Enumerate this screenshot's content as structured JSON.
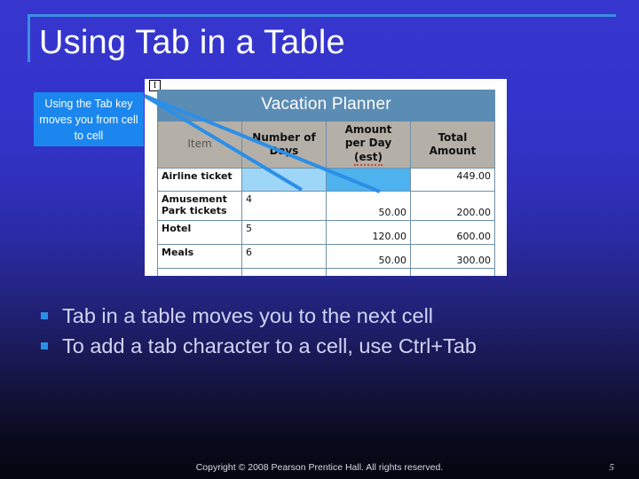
{
  "slide": {
    "title": "Using Tab in a Table",
    "background_top_color": "#3636cf",
    "background_bottom_color": "#050510",
    "accent_color": "#3b8fe0"
  },
  "callout": {
    "text": "Using the Tab key moves you from cell to cell",
    "fill_color": "#1b87ee",
    "text_color": "#ffffff"
  },
  "screenshot": {
    "cursor_icon": "text-cursor-icon",
    "cursor_glyph": "I"
  },
  "word_table": {
    "title": "Vacation Planner",
    "title_fill": "#5b8cb4",
    "header_fill": "#b4b0a8",
    "headers": [
      "Item",
      "Number of Days",
      "Amount per Day (est)",
      "Total Amount"
    ],
    "header_parts": {
      "item": "Item",
      "days_l1": "Number of",
      "days_l2": "Days",
      "amount_l1": "Amount",
      "amount_l2": "per Day",
      "amount_l3": "(est)",
      "total_l1": "Total",
      "total_l2": "Amount"
    },
    "rows": [
      {
        "item": "Airline ticket",
        "days": "",
        "amount": "",
        "total": "449.00",
        "selected": true
      },
      {
        "item": "Amusement Park tickets",
        "days": "4",
        "amount": "50.00",
        "total": "200.00",
        "selected": false
      },
      {
        "item": "Hotel",
        "days": "5",
        "amount": "120.00",
        "total": "600.00",
        "selected": false
      },
      {
        "item": "Meals",
        "days": "6",
        "amount": "50.00",
        "total": "300.00",
        "selected": false
      },
      {
        "item": "",
        "days": "",
        "amount": "",
        "total": "",
        "selected": false
      }
    ],
    "selection_colors": {
      "days_cell": "#9ed6f7",
      "amount_cell": "#4db2ee"
    }
  },
  "bullets": [
    "Tab in a table moves you to the next cell",
    "To add a tab character to a cell, use Ctrl+Tab"
  ],
  "footer": {
    "copyright": "Copyright © 2008 Pearson Prentice Hall. All rights reserved.",
    "page_number": "5"
  }
}
